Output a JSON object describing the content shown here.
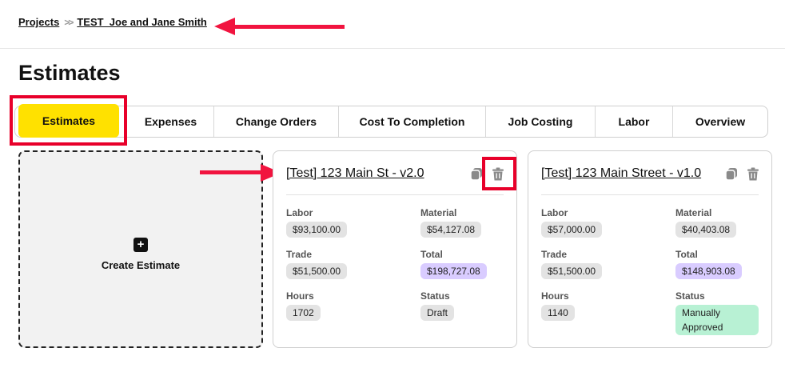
{
  "breadcrumb": {
    "projects": "Projects",
    "separator": ">>",
    "current": "TEST_Joe and Jane Smith"
  },
  "page_title": "Estimates",
  "tabs": [
    {
      "label": "Estimates",
      "active": true
    },
    {
      "label": "Expenses"
    },
    {
      "label": "Change Orders"
    },
    {
      "label": "Cost To Completion"
    },
    {
      "label": "Job Costing"
    },
    {
      "label": "Labor"
    },
    {
      "label": "Overview"
    }
  ],
  "create_card": {
    "icon": "plus-icon",
    "plus_symbol": "+",
    "label": "Create Estimate"
  },
  "estimates": [
    {
      "title": "[Test] 123 Main St - v2.0",
      "labor_label": "Labor",
      "labor": "$93,100.00",
      "material_label": "Material",
      "material": "$54,127.08",
      "trade_label": "Trade",
      "trade": "$51,500.00",
      "total_label": "Total",
      "total": "$198,727.08",
      "hours_label": "Hours",
      "hours": "1702",
      "status_label": "Status",
      "status": "Draft"
    },
    {
      "title": "[Test] 123 Main Street - v1.0",
      "labor_label": "Labor",
      "labor": "$57,000.00",
      "material_label": "Material",
      "material": "$40,403.08",
      "trade_label": "Trade",
      "trade": "$51,500.00",
      "total_label": "Total",
      "total": "$148,903.08",
      "hours_label": "Hours",
      "hours": "1140",
      "status_label": "Status",
      "status": "Manually Approved"
    }
  ],
  "colors": {
    "active_tab": "#ffe100",
    "annotation": "#e8002a",
    "total_pill": "#d9ccff",
    "approved_pill": "#b8f1d4"
  }
}
